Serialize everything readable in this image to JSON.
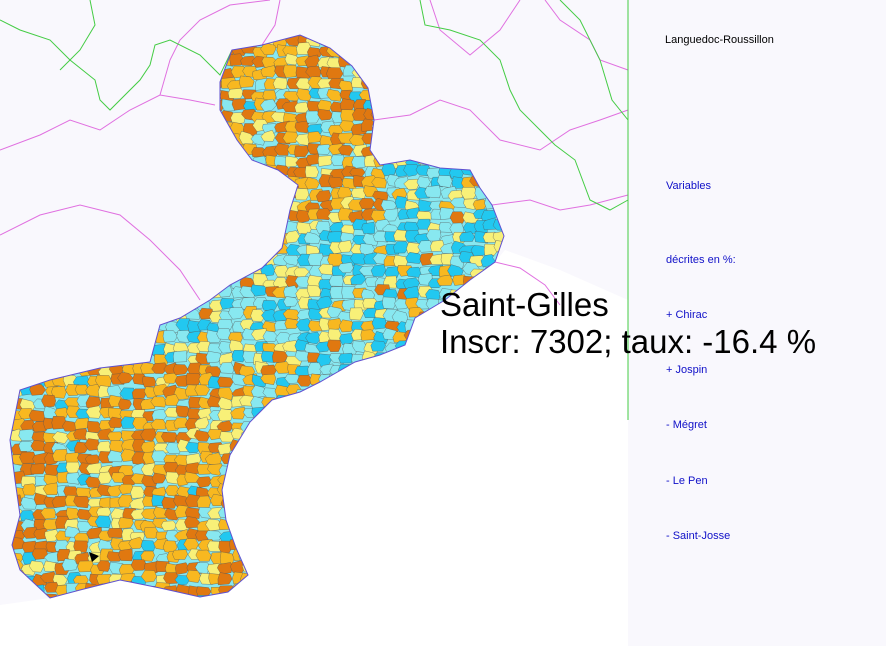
{
  "region_title": "Languedoc-Roussillon",
  "legend": {
    "heading": "Variables",
    "subheading": "décrites en %:",
    "items": [
      "+ Chirac",
      "+ Jospin",
      "- Mégret",
      "- Le Pen",
      "- Saint-Josse"
    ]
  },
  "tooltip": {
    "commune": "Saint-Gilles",
    "detail": "Inscr: 7302; taux: -16.4 %"
  },
  "colors": {
    "background": "#f9f8fd",
    "sea": "#ffffff",
    "department_border": "#e070e0",
    "region_border": "#44cc44",
    "commune_border": "#555555",
    "class_palette": [
      "#e07810",
      "#f8b820",
      "#f8f078",
      "#88e8f0",
      "#22c8f0"
    ],
    "side_text": "#1010c8"
  }
}
